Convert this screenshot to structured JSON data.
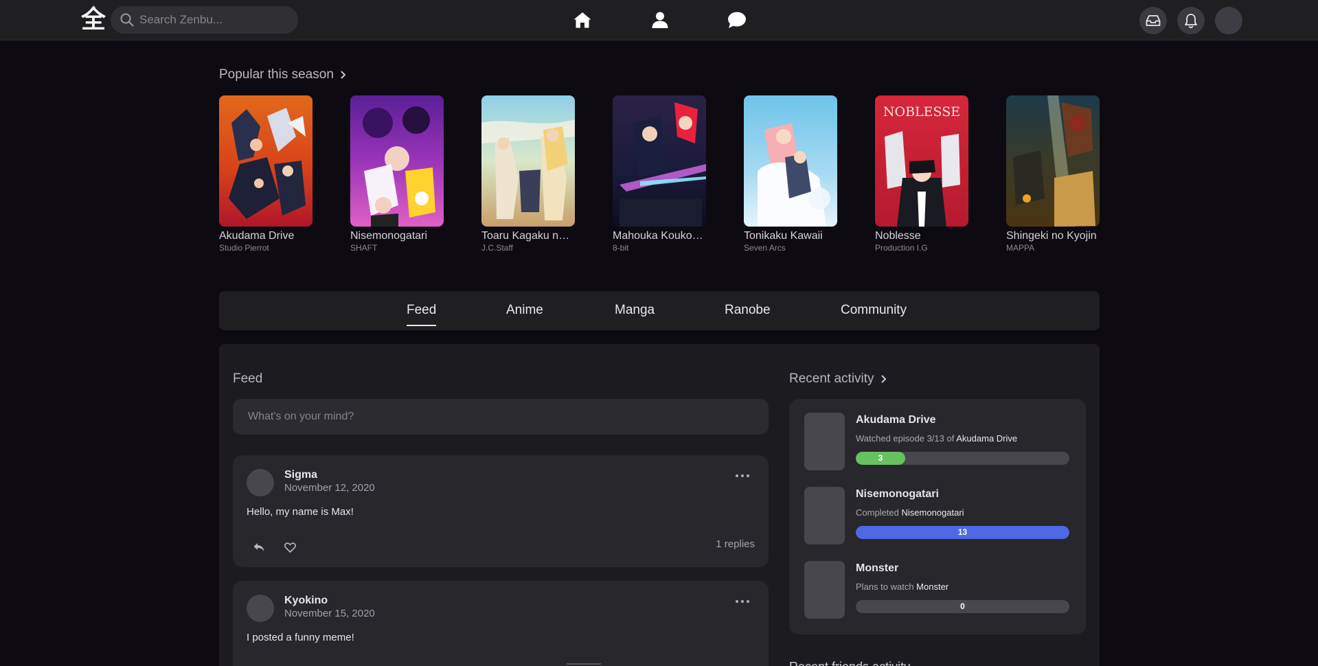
{
  "colors": {
    "accent_watching": "#67c15e",
    "accent_completed": "#4f68e4",
    "planned": "#48474e",
    "background": "#0e0a12",
    "panel": "#1f1f22"
  },
  "topbar": {
    "logo_glyph": "全",
    "search_placeholder": "Search Zenbu...",
    "nav_icons": [
      "home-icon",
      "profile-icon",
      "chat-icon"
    ],
    "right_icons": [
      "inbox-icon",
      "bell-icon",
      "avatar"
    ]
  },
  "popular": {
    "title": "Popular this season",
    "cards": [
      {
        "title": "Akudama Drive",
        "studio": "Studio Pierrot"
      },
      {
        "title": "Nisemonogatari",
        "studio": "SHAFT"
      },
      {
        "title": "Toaru Kagaku no Railgun T",
        "studio": "J.C.Staff"
      },
      {
        "title": "Mahouka Koukou no Rettousei",
        "studio": "8-bit"
      },
      {
        "title": "Tonikaku Kawaii",
        "studio": "Seven Arcs"
      },
      {
        "title": "Noblesse",
        "studio": "Production I.G"
      },
      {
        "title": "Shingeki no Kyojin",
        "studio": "MAPPA"
      }
    ],
    "poster_logo_text": "NOBLESSE"
  },
  "tabs": [
    {
      "label": "Feed",
      "active": true
    },
    {
      "label": "Anime",
      "active": false
    },
    {
      "label": "Manga",
      "active": false
    },
    {
      "label": "Ranobe",
      "active": false
    },
    {
      "label": "Community",
      "active": false
    }
  ],
  "feed": {
    "title": "Feed",
    "composer_placeholder": "What's on your mind?",
    "posts": [
      {
        "author": "Sigma",
        "date": "November 12, 2020",
        "body": "Hello, my name is Max!",
        "replies": "1 replies"
      },
      {
        "author": "Kyokino",
        "date": "November 15, 2020",
        "body": "I posted a funny meme!"
      }
    ]
  },
  "activity": {
    "title": "Recent activity",
    "items": [
      {
        "title": "Akudama Drive",
        "desc_prefix": "Watched episode 3/13 of",
        "desc_target": "Akudama Drive",
        "count": "3",
        "progress": 0.23,
        "status": "watching"
      },
      {
        "title": "Nisemonogatari",
        "desc_prefix": "Completed",
        "desc_target": "Nisemonogatari",
        "count": "13",
        "progress": 1.0,
        "status": "completed"
      },
      {
        "title": "Monster",
        "desc_prefix": "Plans to watch",
        "desc_target": "Monster",
        "count": "0",
        "progress": 0.0,
        "status": "planned"
      }
    ],
    "next_section_title": "Recent friends activity"
  }
}
